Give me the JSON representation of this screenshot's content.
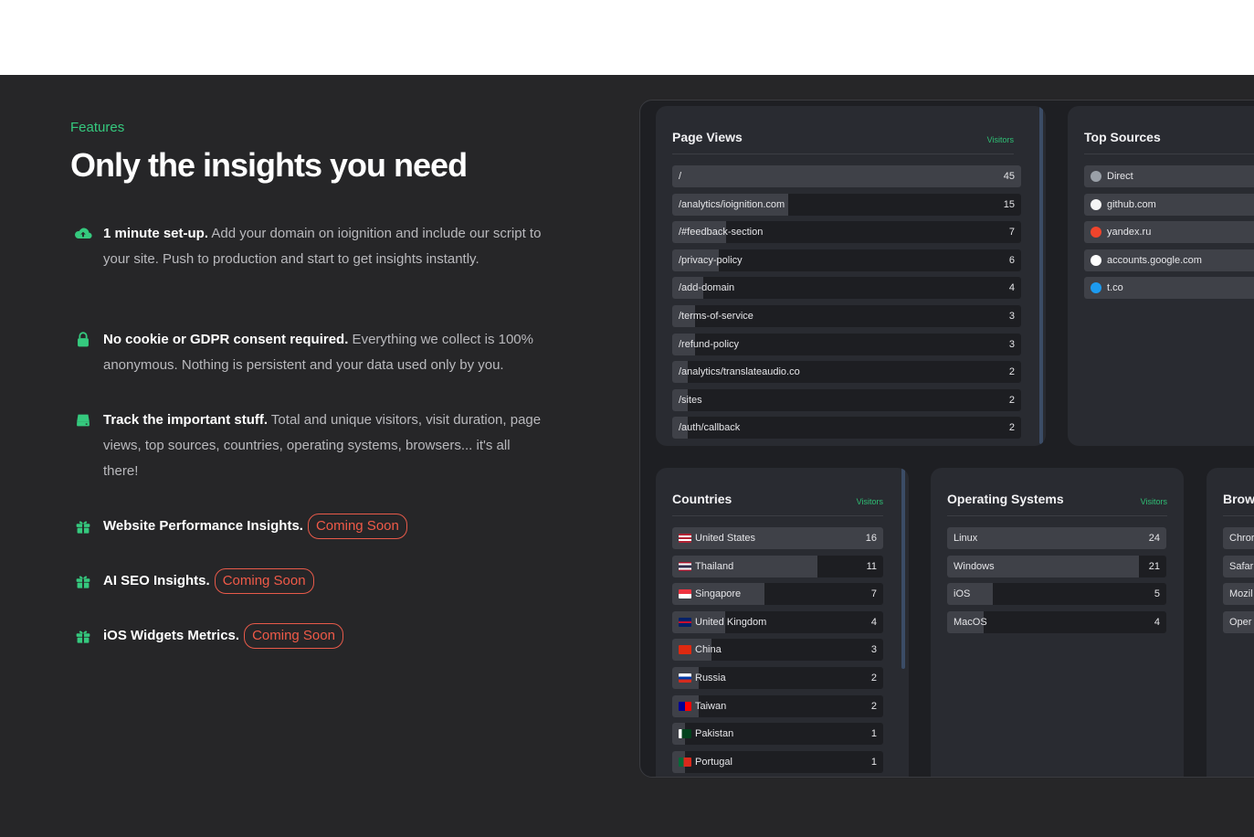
{
  "features": {
    "eyebrow": "Features",
    "headline": "Only the insights you need",
    "items": [
      {
        "icon": "cloud-upload-icon",
        "bold": "1 minute set-up.",
        "text": " Add your domain on ioignition and include our script to your site. Push to production and start to get insights instantly."
      },
      {
        "icon": "lock-icon",
        "bold": "No cookie or GDPR consent required.",
        "text": " Everything we collect is 100% anonymous. Nothing is persistent and your data used only by you."
      },
      {
        "icon": "hard-drive-icon",
        "bold": "Track the important stuff.",
        "text": " Total and unique visitors, visit duration, page views, top sources, countries, operating systems, browsers... it's all there!"
      },
      {
        "icon": "gift-icon",
        "bold": "Website Performance Insights.",
        "badge": "Coming Soon"
      },
      {
        "icon": "gift-icon",
        "bold": "AI SEO Insights.",
        "badge": "Coming Soon"
      },
      {
        "icon": "gift-icon",
        "bold": "iOS Widgets Metrics.",
        "badge": "Coming Soon"
      }
    ]
  },
  "dashboard": {
    "page_views": {
      "title": "Page Views",
      "sub": "Visitors",
      "rows": [
        {
          "label": "/",
          "value": "45"
        },
        {
          "label": "/analytics/ioignition.com",
          "value": "15"
        },
        {
          "label": "/#feedback-section",
          "value": "7"
        },
        {
          "label": "/privacy-policy",
          "value": "6"
        },
        {
          "label": "/add-domain",
          "value": "4"
        },
        {
          "label": "/terms-of-service",
          "value": "3"
        },
        {
          "label": "/refund-policy",
          "value": "3"
        },
        {
          "label": "/analytics/translateaudio.co",
          "value": "2"
        },
        {
          "label": "/sites",
          "value": "2"
        },
        {
          "label": "/auth/callback",
          "value": "2"
        }
      ]
    },
    "top_sources": {
      "title": "Top Sources",
      "rows": [
        {
          "label": "Direct",
          "icon": "globe-icon",
          "color": "#9aa0a8"
        },
        {
          "label": "github.com",
          "icon": "github-icon",
          "color": "#f5f5f5"
        },
        {
          "label": "yandex.ru",
          "icon": "yandex-icon",
          "color": "#f0442c"
        },
        {
          "label": "accounts.google.com",
          "icon": "google-icon",
          "color": "#ffffff"
        },
        {
          "label": "t.co",
          "icon": "twitter-icon",
          "color": "#1d9bf0"
        }
      ]
    },
    "countries": {
      "title": "Countries",
      "sub": "Visitors",
      "rows": [
        {
          "label": "United States",
          "value": "16",
          "flag": "us-flag-icon"
        },
        {
          "label": "Thailand",
          "value": "11",
          "flag": "th-flag-icon"
        },
        {
          "label": "Singapore",
          "value": "7",
          "flag": "sg-flag-icon"
        },
        {
          "label": "United Kingdom",
          "value": "4",
          "flag": "gb-flag-icon"
        },
        {
          "label": "China",
          "value": "3",
          "flag": "cn-flag-icon"
        },
        {
          "label": "Russia",
          "value": "2",
          "flag": "ru-flag-icon"
        },
        {
          "label": "Taiwan",
          "value": "2",
          "flag": "tw-flag-icon"
        },
        {
          "label": "Pakistan",
          "value": "1",
          "flag": "pk-flag-icon"
        },
        {
          "label": "Portugal",
          "value": "1",
          "flag": "pt-flag-icon"
        }
      ]
    },
    "operating_systems": {
      "title": "Operating Systems",
      "sub": "Visitors",
      "rows": [
        {
          "label": "Linux",
          "value": "24"
        },
        {
          "label": "Windows",
          "value": "21"
        },
        {
          "label": "iOS",
          "value": "5"
        },
        {
          "label": "MacOS",
          "value": "4"
        }
      ]
    },
    "browsers": {
      "title": "Brow",
      "rows": [
        {
          "label": "Chror"
        },
        {
          "label": "Safar"
        },
        {
          "label": "Mozil"
        },
        {
          "label": "Oper"
        }
      ]
    }
  },
  "colors": {
    "accent": "#35c97e",
    "badge": "#f05a48",
    "background": "#262628",
    "card": "#292b31"
  }
}
